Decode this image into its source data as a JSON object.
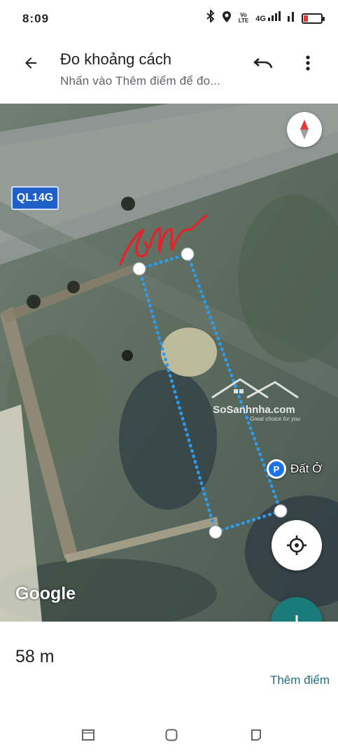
{
  "status_bar": {
    "time": "8:09",
    "icons": [
      "bluetooth-icon",
      "location-icon",
      "volte-icon",
      "signal-4g-icon",
      "signal-icon",
      "battery-low-icon"
    ],
    "volte_top": "Vo",
    "volte_bottom": "LTE",
    "network": "4G"
  },
  "app_bar": {
    "title": "Đo khoảng cách",
    "subtitle": "Nhấn vào Thêm điểm để đo...",
    "back_icon": "arrow-back-icon",
    "undo_icon": "undo-icon",
    "more_icon": "more-vert-icon"
  },
  "map": {
    "road_label": "QL14G",
    "annotation": "6m",
    "annotation_color": "#e8202a",
    "measure_line_color": "#2f9be8",
    "poi_label": "Đất Ở",
    "poi_icon": "P",
    "watermark": "SoSanhnha.com",
    "watermark_slogan": "Great choice for you",
    "attribution": "Google"
  },
  "measurement": {
    "distance": "58 m",
    "add_point_label": "Thêm điểm"
  },
  "accent_color": "#1b7a7a",
  "nav_bar": {
    "buttons": [
      "recent-apps-icon",
      "home-icon",
      "back-nav-icon"
    ]
  }
}
